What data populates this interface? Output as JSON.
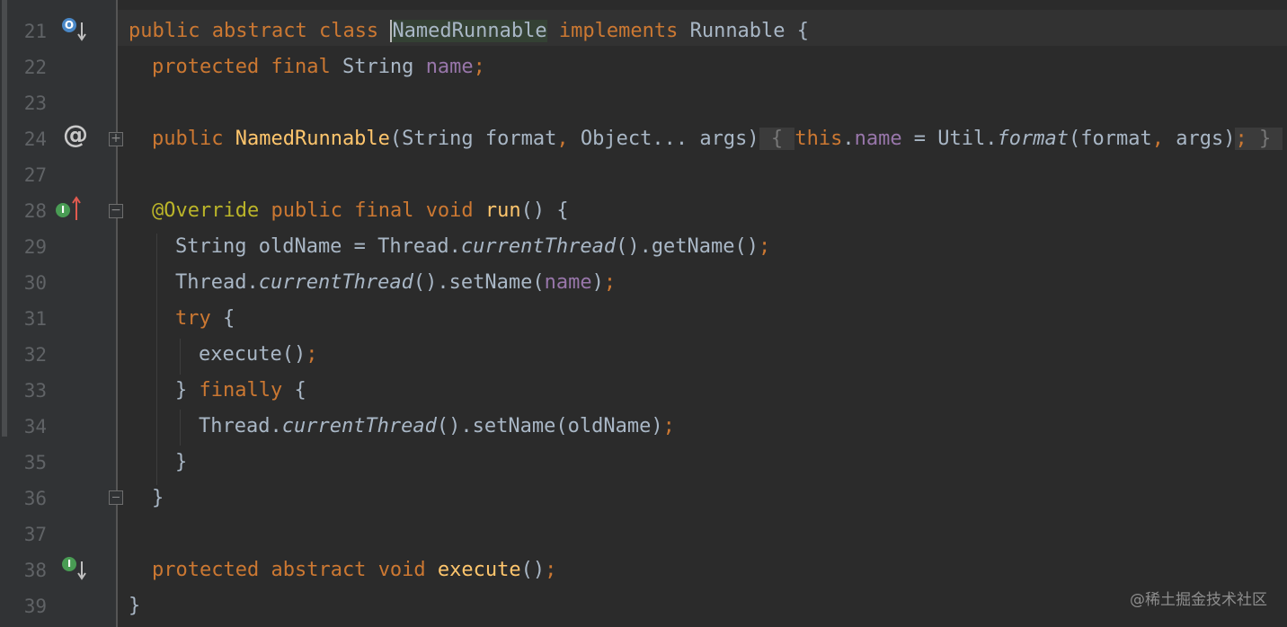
{
  "editor": {
    "line_numbers": [
      "21",
      "22",
      "23",
      "24",
      "27",
      "28",
      "29",
      "30",
      "31",
      "32",
      "33",
      "34",
      "35",
      "36",
      "37",
      "38",
      "39"
    ],
    "watermark": "@稀土掘金技术社区",
    "gutter_icons": {
      "line21": "override-down-arrow-icon",
      "line24": "annotation-at-icon",
      "line28": "implementing-up-arrow-icon",
      "line38": "implemented-down-arrow-icon"
    }
  },
  "code": {
    "l21": {
      "public": "public",
      "abstract": "abstract",
      "class": "class",
      "name": "NamedRunnable",
      "implements": "implements",
      "iface": "Runnable",
      "brace": "{"
    },
    "l22": {
      "protected": "protected",
      "final": "final",
      "type": "String",
      "field": "name",
      "semi": ";"
    },
    "l24": {
      "public": "public",
      "name": "NamedRunnable",
      "paren_open": "(",
      "p1type": "String",
      "p1": "format",
      "comma1": ",",
      "p2type": "Object...",
      "p2": "args",
      "paren_close": ")",
      "lbrace": "{",
      "this": "this",
      "dot": ".",
      "field": "name",
      "assign": " = Util.",
      "call": "format",
      "args_open": "(format",
      "comma2": ",",
      "args_rest": "args)",
      "semi": ";",
      "rbrace": "}"
    },
    "l28": {
      "annotation": "@Override",
      "public": "public",
      "final": "final",
      "void": "void",
      "name": "run",
      "rest": "() {"
    },
    "l29": {
      "a": "String oldName = Thread.",
      "call": "currentThread",
      "b": "().getName()",
      "semi": ";"
    },
    "l30": {
      "a": "Thread.",
      "call": "currentThread",
      "b": "().setName(",
      "field": "name",
      "c": ")",
      "semi": ";"
    },
    "l31": {
      "try": "try",
      "rest": "{"
    },
    "l32": {
      "a": "execute()",
      "semi": ";"
    },
    "l33": {
      "a": "}",
      "finally": "finally",
      "rest": "{"
    },
    "l34": {
      "a": "Thread.",
      "call": "currentThread",
      "b": "().setName(oldName)",
      "semi": ";"
    },
    "l35": {
      "a": "}"
    },
    "l36": {
      "a": "}"
    },
    "l38": {
      "protected": "protected",
      "abstract": "abstract",
      "void": "void",
      "name": "execute",
      "rest": "()",
      "semi": ";"
    },
    "l39": {
      "a": "}"
    }
  },
  "colors": {
    "background": "#2b2b2b",
    "keyword": "#cc7832",
    "field": "#9876aa",
    "function": "#ffc66d",
    "annotation": "#bbb529",
    "text": "#a9b7c6"
  }
}
